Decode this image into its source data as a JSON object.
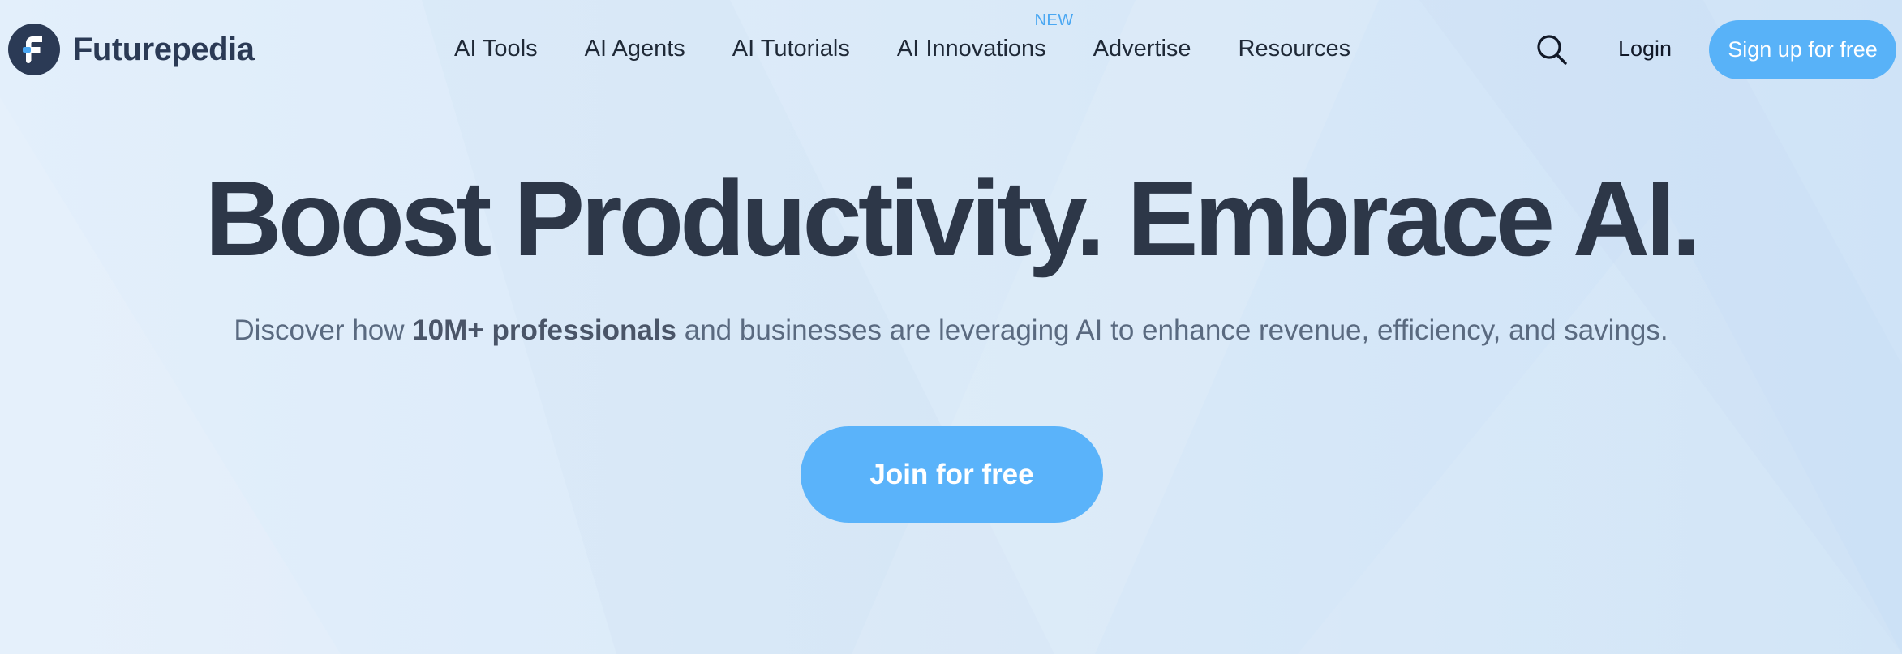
{
  "logo": {
    "name": "Futurepedia",
    "icon": "futurepedia-logo-icon"
  },
  "nav": {
    "items": [
      {
        "label": "AI Tools"
      },
      {
        "label": "AI Agents"
      },
      {
        "label": "AI Tutorials"
      },
      {
        "label": "AI Innovations",
        "badge": "NEW"
      },
      {
        "label": "Advertise"
      },
      {
        "label": "Resources"
      }
    ],
    "search_icon": "search-icon",
    "login_label": "Login",
    "signup_label": "Sign up for free"
  },
  "hero": {
    "title": "Boost Productivity. Embrace AI.",
    "subtitle_prefix": "Discover how ",
    "subtitle_highlight": "10M+ professionals",
    "subtitle_suffix": " and businesses are leveraging AI to enhance revenue, efficiency, and savings.",
    "cta_label": "Join for free"
  },
  "colors": {
    "accent": "#58b2f8",
    "badge": "#4aa7f2",
    "heading": "#2d3748",
    "logo_dark": "#2b3a55"
  }
}
